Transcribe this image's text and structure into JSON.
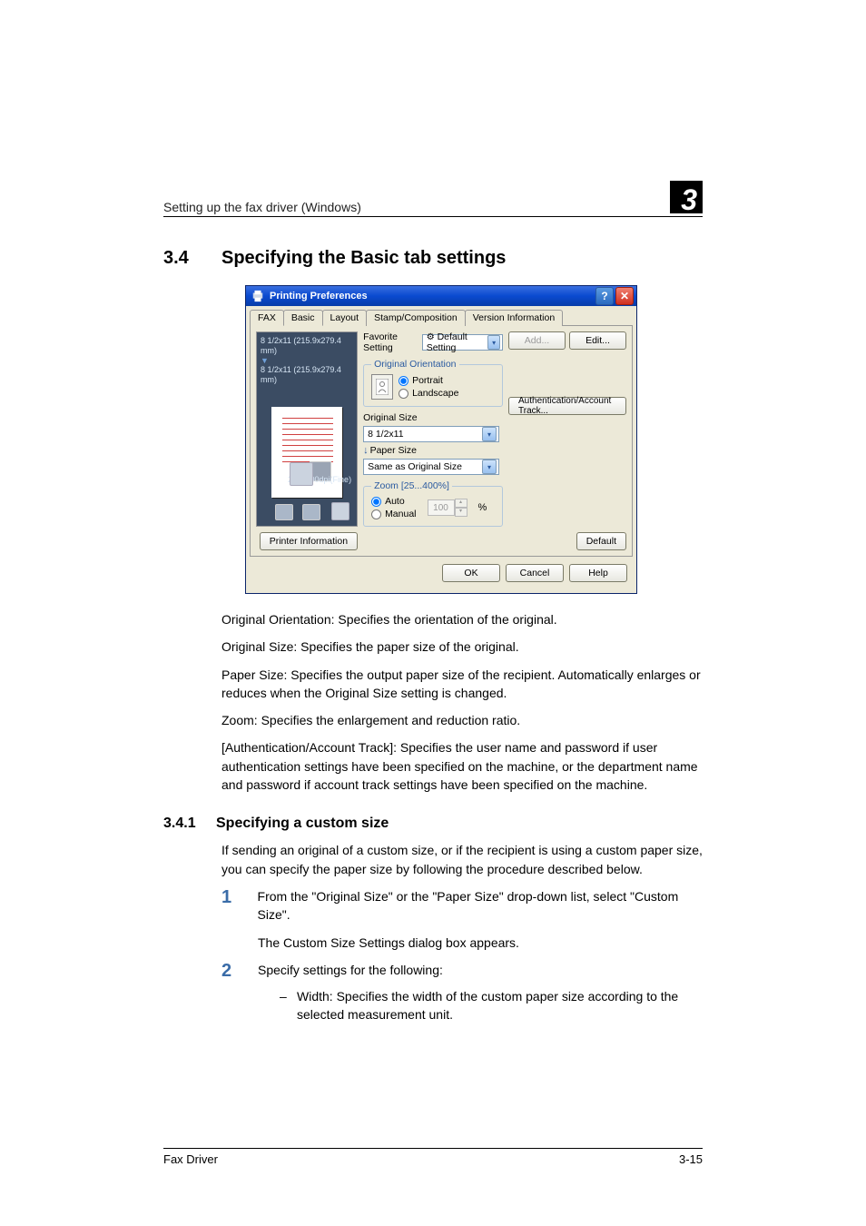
{
  "header": {
    "left": "Setting up the fax driver (Windows)",
    "chapter_number": "3"
  },
  "section": {
    "number": "3.4",
    "title": "Specifying the Basic tab settings"
  },
  "dialog": {
    "title": "Printing Preferences",
    "tabs": [
      "FAX",
      "Basic",
      "Layout",
      "Stamp/Composition",
      "Version Information"
    ],
    "active_tab": 1,
    "preview": {
      "line1": "8 1/2x11 (215.9x279.4 mm)",
      "line2": "8 1/2x11 (215.9x279.4 mm)",
      "dpi": "200x200dpi(Fine)"
    },
    "printer_info_button": "Printer Information",
    "favorite": {
      "label": "Favorite Setting",
      "value": "Default Setting",
      "add_button": "Add...",
      "edit_button": "Edit..."
    },
    "orientation": {
      "legend": "Original Orientation",
      "portrait": "Portrait",
      "landscape": "Landscape",
      "selected": "portrait"
    },
    "original_size": {
      "label": "Original Size",
      "value": "8 1/2x11"
    },
    "paper_size": {
      "label": "Paper Size",
      "value": "Same as Original Size"
    },
    "zoom": {
      "legend": "Zoom [25...400%]",
      "auto": "Auto",
      "manual": "Manual",
      "value": "100",
      "percent": "%",
      "selected": "auto"
    },
    "auth_button": "Authentication/Account Track...",
    "default_button": "Default",
    "ok": "OK",
    "cancel": "Cancel",
    "help": "Help"
  },
  "paragraphs": {
    "p1": "Original Orientation: Specifies the orientation of the original.",
    "p2": "Original Size: Specifies the paper size of the original.",
    "p3": "Paper Size: Specifies the output paper size of the recipient. Automatically enlarges or reduces when the Original Size setting is changed.",
    "p4": "Zoom: Specifies the enlargement and reduction ratio.",
    "p5": "[Authentication/Account Track]: Specifies the user name and password if user authentication settings have been specified on the machine, or the department name and password if account track settings have been specified on the machine."
  },
  "subsection": {
    "number": "3.4.1",
    "title": "Specifying a custom size",
    "intro": "If sending an original of a custom size, or if the recipient is using a custom paper size, you can specify the paper size by following the procedure described below.",
    "steps": {
      "s1": "From the \"Original Size\" or the \"Paper Size\" drop-down list, select \"Custom Size\".",
      "s1b": "The Custom Size Settings dialog box appears.",
      "s2": "Specify settings for the following:",
      "s2a": "Width: Specifies the width of the custom paper size according to the selected measurement unit."
    },
    "num1": "1",
    "num2": "2"
  },
  "footer": {
    "left": "Fax Driver",
    "right": "3-15"
  }
}
